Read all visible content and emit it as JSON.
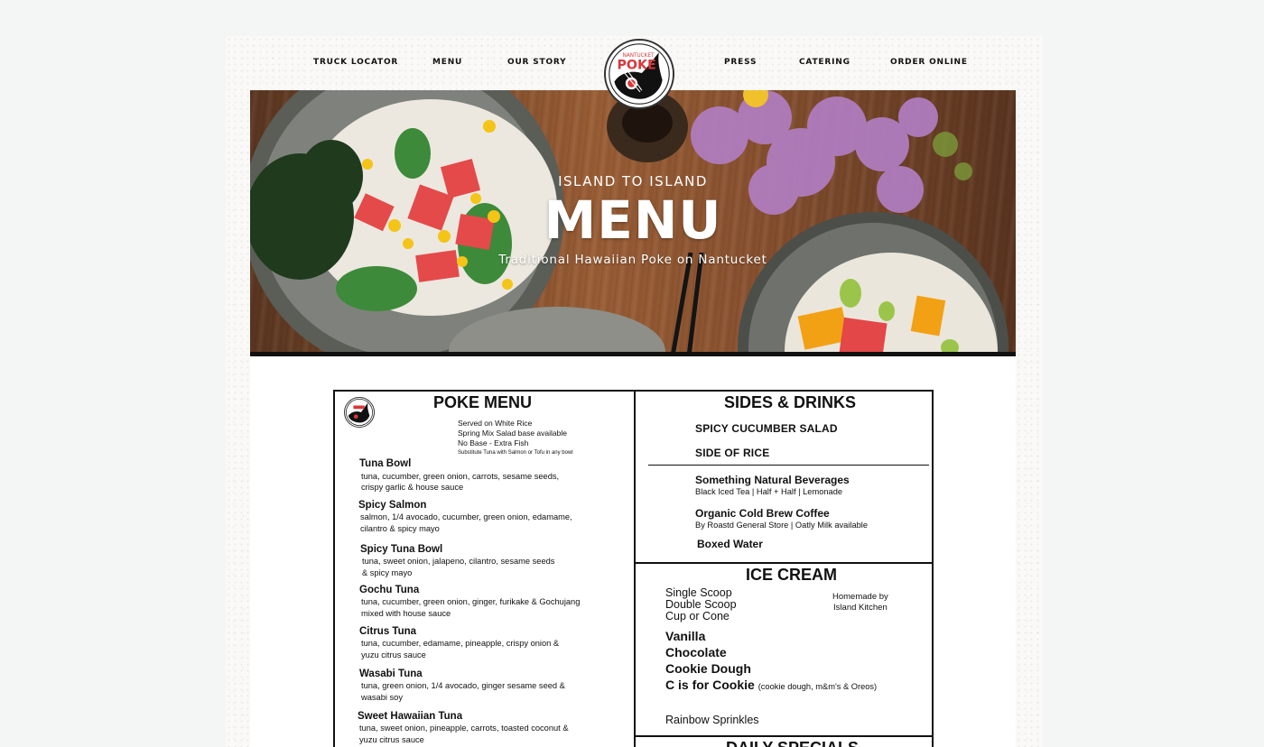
{
  "nav": {
    "items": [
      "TRUCK LOCATOR",
      "MENU",
      "OUR STORY",
      "PRESS",
      "CATERING",
      "ORDER ONLINE"
    ]
  },
  "logo": {
    "line1": "NANTUCKET",
    "line2": "POKE"
  },
  "hero": {
    "tagline": "ISLAND TO ISLAND",
    "title": "MENU",
    "subtitle": "Traditional Hawaiian Poke on Nantucket"
  },
  "poke_menu": {
    "title": "POKE MENU",
    "served": [
      "Served on White Rice",
      "Spring Mix Salad base available",
      "No Base - Extra Fish"
    ],
    "substitute_note": "Substitute Tuna with Salmon or Tofu in any bowl",
    "items": [
      {
        "name": "Tuna Bowl",
        "desc1": "tuna, cucumber, green onion, carrots, sesame seeds,",
        "desc2": "crispy garlic & house sauce"
      },
      {
        "name": "Spicy Salmon",
        "desc1": "salmon, 1/4 avocado, cucumber, green onion, edamame,",
        "desc2": "cilantro & spicy mayo"
      },
      {
        "name": "Spicy Tuna Bowl",
        "desc1": "tuna, sweet onion, jalapeno, cilantro, sesame seeds",
        "desc2": "& spicy mayo"
      },
      {
        "name": "Gochu Tuna",
        "desc1": "tuna, cucumber, green onion, ginger, furikake & Gochujang",
        "desc2": "mixed with house sauce"
      },
      {
        "name": "Citrus Tuna",
        "desc1": "tuna, cucumber, edamame, pineapple, crispy onion &",
        "desc2": "yuzu citrus sauce"
      },
      {
        "name": "Wasabi Tuna",
        "desc1": "tuna, green onion, 1/4 avocado, ginger sesame seed &",
        "desc2": "wasabi soy"
      },
      {
        "name": "Sweet Hawaiian Tuna",
        "desc1": "tuna, sweet onion, pineapple, carrots, toasted coconut &",
        "desc2": "yuzu citrus sauce"
      }
    ]
  },
  "sides": {
    "title": "SIDES & DRINKS",
    "items": [
      "SPICY CUCUMBER SALAD",
      "SIDE OF RICE"
    ],
    "drinks": [
      {
        "name": "Something Natural Beverages",
        "desc": "Black Iced Tea  |  Half + Half  |  Lemonade"
      },
      {
        "name": "Organic Cold Brew Coffee",
        "desc": "By Roastd General Store | Oatly Milk available"
      },
      {
        "name": "Boxed Water",
        "desc": ""
      }
    ]
  },
  "ice_cream": {
    "title": "ICE CREAM",
    "sizes": [
      "Single Scoop",
      "Double Scoop",
      "Cup or Cone"
    ],
    "homemade": [
      "Homemade by",
      "Island Kitchen"
    ],
    "flavors": [
      "Vanilla",
      "Chocolate",
      "Cookie Dough",
      "C is for Cookie"
    ],
    "cookie_note": "(cookie dough, m&m's & Oreos)",
    "extra": "Rainbow Sprinkles"
  },
  "daily_specials": {
    "title": "DAILY SPECIALS"
  }
}
